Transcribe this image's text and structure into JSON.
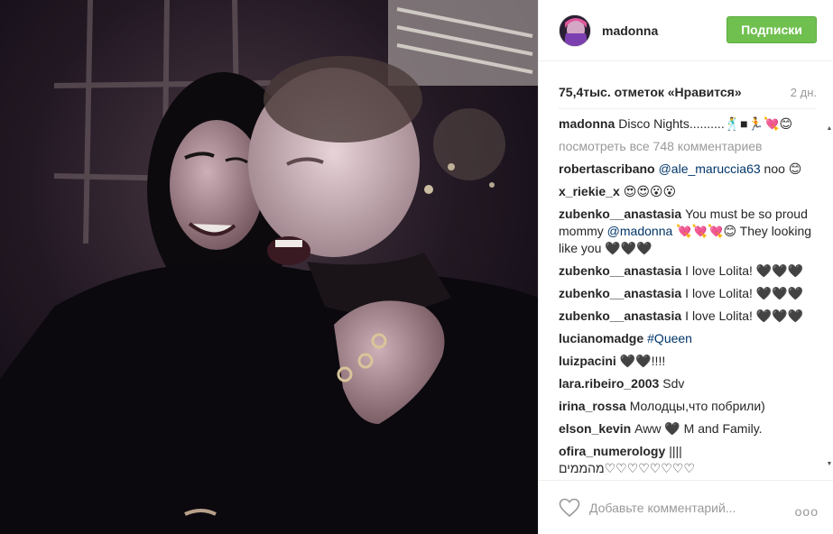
{
  "post": {
    "username": "madonna",
    "follow_label": "Подписки",
    "likes": "75,4тыс. отметок «Нравится»",
    "age": "2 дн.",
    "caption": {
      "user": "madonna",
      "text": "Disco Nights..........🕺■🏃💘😊"
    },
    "view_all": "посмотреть все 748 комментариев",
    "add_comment_placeholder": "Добавьте комментарий...",
    "more_label": "ooo"
  },
  "comments": [
    {
      "user": "robertascribano",
      "mention": "@ale_maruccia63",
      "text": " noo 😊"
    },
    {
      "user": "x_riekie_x",
      "mention": "",
      "text": "😍😍😮😮"
    },
    {
      "user": "zubenko__anastasia",
      "mention": "",
      "text": "You must be so proud mommy ",
      "mention2": "@madonna",
      "text2": " 💘💘💘😊 They looking like you 🖤🖤🖤"
    },
    {
      "user": "zubenko__anastasia",
      "mention": "",
      "text": "I love Lolita! 🖤🖤🖤"
    },
    {
      "user": "zubenko__anastasia",
      "mention": "",
      "text": "I love Lolita! 🖤🖤🖤"
    },
    {
      "user": "zubenko__anastasia",
      "mention": "",
      "text": "I love Lolita! 🖤🖤🖤"
    },
    {
      "user": "lucianomadge",
      "mention": "#Queen",
      "text": ""
    },
    {
      "user": "luizpacini",
      "mention": "",
      "text": "🖤🖤!!!!"
    },
    {
      "user": "lara.ribeiro_2003",
      "mention": "",
      "text": "Sdv"
    },
    {
      "user": "irina_rossa",
      "mention": "",
      "text": "Молодцы,что побрили)"
    },
    {
      "user": "elson_kevin",
      "mention": "",
      "text": "Aww 🖤 M and Family."
    },
    {
      "user": "ofira_numerology",
      "mention": "",
      "text": "||||מהממים♡♡♡♡♡♡♡♡"
    }
  ],
  "icons": {
    "like": "heart-outline-icon",
    "more": "more-dots-icon",
    "scroll_up": "scroll-up-arrow-icon",
    "scroll_down": "scroll-down-arrow-icon"
  },
  "colors": {
    "follow": "#70c050",
    "mention": "#003569",
    "muted": "#999999"
  }
}
